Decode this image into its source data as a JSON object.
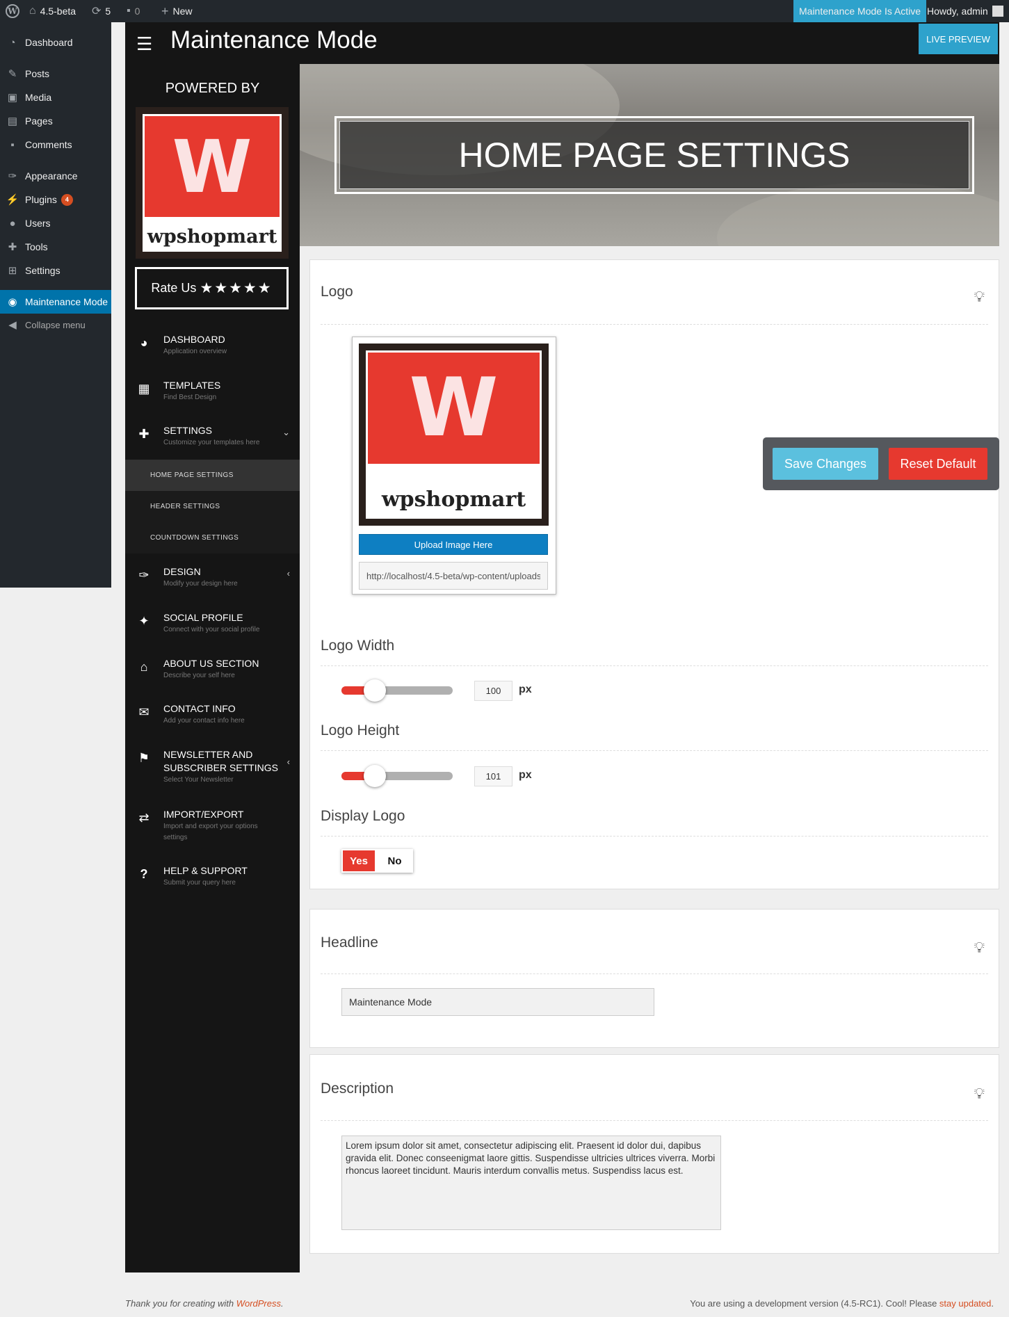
{
  "admin_bar": {
    "site_name": "4.5-beta",
    "updates_count": "5",
    "comments_count": "0",
    "new_label": "New",
    "maintenance_status": "Maintenance Mode Is Active",
    "greeting": "Howdy, admin"
  },
  "wp_menu": {
    "items": [
      {
        "label": "Dashboard",
        "icon": "dashboard-icon"
      },
      {
        "label": "Posts",
        "icon": "pin-icon"
      },
      {
        "label": "Media",
        "icon": "media-icon"
      },
      {
        "label": "Pages",
        "icon": "pages-icon"
      },
      {
        "label": "Comments",
        "icon": "comment-icon"
      },
      {
        "label": "Appearance",
        "icon": "brush-icon"
      },
      {
        "label": "Plugins",
        "icon": "plugin-icon",
        "badge": "4"
      },
      {
        "label": "Users",
        "icon": "user-icon"
      },
      {
        "label": "Tools",
        "icon": "wrench-icon"
      },
      {
        "label": "Settings",
        "icon": "settings-icon"
      },
      {
        "label": "Maintenance Mode",
        "icon": "eye-icon"
      },
      {
        "label": "Collapse menu",
        "icon": "collapse-icon"
      }
    ]
  },
  "plugin_header": {
    "title": "Maintenance Mode",
    "live_preview": "LIVE PREVIEW"
  },
  "plugin_sidebar": {
    "powered_by": "POWERED BY",
    "logo_letter": "W",
    "logo_text": "wpshopmart",
    "rate_us": "Rate Us",
    "stars": "★★★★★",
    "nav": [
      {
        "title": "DASHBOARD",
        "subtitle": "Application overview",
        "icon": "speedometer-icon"
      },
      {
        "title": "TEMPLATES",
        "subtitle": "Find Best Design",
        "icon": "grid-icon"
      },
      {
        "title": "SETTINGS",
        "subtitle": "Customize your templates here",
        "icon": "wrench-icon"
      },
      {
        "title": "DESIGN",
        "subtitle": "Modify your design here",
        "icon": "brush-icon"
      },
      {
        "title": "SOCIAL PROFILE",
        "subtitle": "Connect with your social profile",
        "icon": "twitter-icon"
      },
      {
        "title": "ABOUT US SECTION",
        "subtitle": "Describe your self here",
        "icon": "home-icon"
      },
      {
        "title": "CONTACT INFO",
        "subtitle": "Add your contact info here",
        "icon": "envelope-icon"
      },
      {
        "title": "NEWSLETTER AND",
        "title2": "SUBSCRIBER SETTINGS",
        "subtitle": "Select Your Newsletter",
        "icon": "flag-icon"
      },
      {
        "title": "IMPORT/EXPORT",
        "subtitle": "Import and export your options",
        "subtitle2": "settings",
        "icon": "exchange-icon"
      },
      {
        "title": "HELP & SUPPORT",
        "subtitle": "Submit your query here",
        "icon": "question-icon"
      }
    ],
    "settings_sub": [
      "HOME PAGE SETTINGS",
      "HEADER SETTINGS",
      "COUNTDOWN SETTINGS"
    ]
  },
  "banner": {
    "title": "HOME PAGE SETTINGS"
  },
  "logo_section": {
    "title": "Logo",
    "upload_label": "Upload Image Here",
    "url_value": "http://localhost/4.5-beta/wp-content/uploads/wpshopmart-logo.png",
    "width_label": "Logo Width",
    "width_value": "100",
    "width_fraction": 0.3,
    "height_label": "Logo Height",
    "height_value": "101",
    "height_fraction": 0.3,
    "unit": "px",
    "display_label": "Display Logo",
    "toggle_yes": "Yes",
    "toggle_no": "No"
  },
  "actions": {
    "save": "Save Changes",
    "reset": "Reset Default"
  },
  "headline_section": {
    "title": "Headline",
    "value": "Maintenance Mode"
  },
  "description_section": {
    "title": "Description",
    "value": "Lorem ipsum dolor sit amet, consectetur adipiscing elit. Praesent id dolor dui, dapibus gravida elit. Donec conseenigmat laore gittis. Suspendisse ultricies ultrices viverra. Morbi rhoncus laoreet tincidunt. Mauris interdum convallis metus. Suspendiss lacus est."
  },
  "footer": {
    "left_prefix": "Thank you for creating with ",
    "left_link": "WordPress",
    "left_suffix": ".",
    "right_prefix": "You are using a development version (4.5-RC1). Cool! Please ",
    "right_link": "stay updated",
    "right_suffix": "."
  },
  "colors": {
    "accent_red": "#e6392f",
    "wp_blue": "#0073aa",
    "live_preview_blue": "#2ea2cc",
    "save_blue": "#5bc0de"
  }
}
